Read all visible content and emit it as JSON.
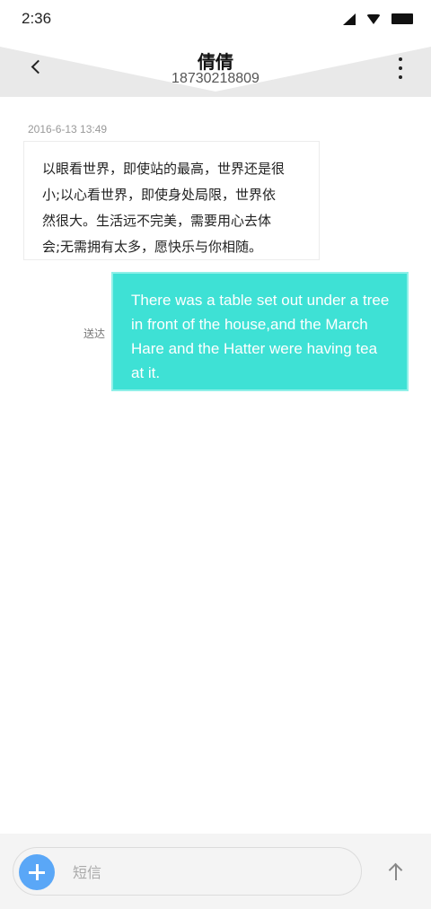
{
  "status_bar": {
    "time": "2:36",
    "icons": [
      "signal-icon",
      "wifi-icon",
      "battery-icon"
    ]
  },
  "header": {
    "contact_name": "倩倩",
    "contact_number": "18730218809",
    "back_icon": "chevron-left-icon",
    "more_icon": "more-vertical-icon"
  },
  "conversation": {
    "timestamp": "2016-6-13 13:49",
    "incoming": {
      "lines": [
        "以眼看世界，即使站的最高，世界还是很",
        "小;以心看世界，即使身处局限，世界依",
        "然很大。生活远不完美，需要用心去体",
        "会;无需拥有太多，愿快乐与你相随。"
      ]
    },
    "outgoing": {
      "lines": [
        "There was a table set out under a tree",
        "in front of the house,and the March",
        "Hare and the Hatter were having tea",
        "at it."
      ],
      "status": "送达"
    }
  },
  "compose": {
    "placeholder": "短信",
    "add_icon": "plus-icon",
    "send_icon": "arrow-up-icon"
  },
  "colors": {
    "outgoing_bubble": "#3ee1d5",
    "add_button": "#5aa7f7"
  }
}
